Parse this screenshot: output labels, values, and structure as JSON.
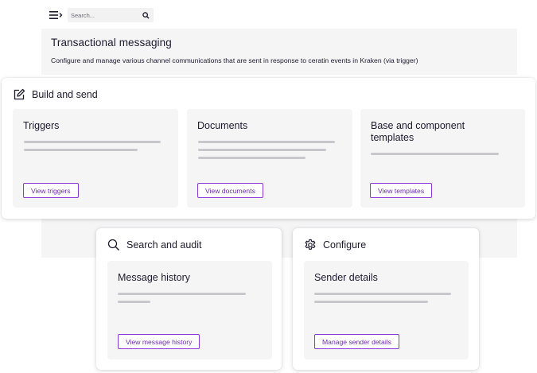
{
  "topbar": {
    "search_placeholder": "Search..."
  },
  "header": {
    "title": "Transactional messaging",
    "description": "Configure and manage various channel communications that are sent in response to ceratin events in Kraken (via trigger)"
  },
  "sections": {
    "build": {
      "title": "Build and send",
      "icon": "edit-icon",
      "tiles": [
        {
          "title": "Triggers",
          "button": "View triggers"
        },
        {
          "title": "Documents",
          "button": "View documents"
        },
        {
          "title": "Base and component templates",
          "button": "View templates"
        }
      ]
    },
    "search": {
      "title": "Search and audit",
      "icon": "search-icon",
      "tiles": [
        {
          "title": "Message history",
          "button": "View message history"
        }
      ]
    },
    "configure": {
      "title": "Configure",
      "icon": "gear-icon",
      "tiles": [
        {
          "title": "Sender details",
          "button": "Manage sender details"
        }
      ]
    }
  },
  "colors": {
    "accent": "#8a3ad6",
    "panel": "#f5f5f6",
    "skeleton": "#c7c7cc"
  }
}
